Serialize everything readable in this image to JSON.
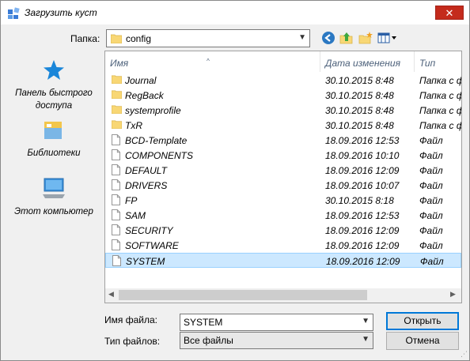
{
  "window": {
    "title": "Загрузить куст",
    "close_glyph": "✕"
  },
  "toolbar": {
    "folder_label": "Папка:",
    "folder_value": "config",
    "icons": [
      "back-icon",
      "up-folder-icon",
      "new-folder-icon",
      "view-menu-icon"
    ]
  },
  "nav": {
    "items": [
      {
        "label": "Панель быстрого доступа",
        "icon": "star-icon"
      },
      {
        "label": "Библиотеки",
        "icon": "libraries-icon"
      },
      {
        "label": "Этот компьютер",
        "icon": "computer-icon"
      }
    ]
  },
  "list": {
    "columns": {
      "name": "Имя",
      "date": "Дата изменения",
      "type": "Тип"
    },
    "sort_arrow": "^",
    "rows": [
      {
        "name": "Journal",
        "date": "30.10.2015 8:48",
        "type": "Папка с ф",
        "kind": "folder",
        "selected": false
      },
      {
        "name": "RegBack",
        "date": "30.10.2015 8:48",
        "type": "Папка с ф",
        "kind": "folder",
        "selected": false
      },
      {
        "name": "systemprofile",
        "date": "30.10.2015 8:48",
        "type": "Папка с ф",
        "kind": "folder",
        "selected": false
      },
      {
        "name": "TxR",
        "date": "30.10.2015 8:48",
        "type": "Папка с ф",
        "kind": "folder",
        "selected": false
      },
      {
        "name": "BCD-Template",
        "date": "18.09.2016 12:53",
        "type": "Файл",
        "kind": "file",
        "selected": false
      },
      {
        "name": "COMPONENTS",
        "date": "18.09.2016 10:10",
        "type": "Файл",
        "kind": "file",
        "selected": false
      },
      {
        "name": "DEFAULT",
        "date": "18.09.2016 12:09",
        "type": "Файл",
        "kind": "file",
        "selected": false
      },
      {
        "name": "DRIVERS",
        "date": "18.09.2016 10:07",
        "type": "Файл",
        "kind": "file",
        "selected": false
      },
      {
        "name": "FP",
        "date": "30.10.2015 8:18",
        "type": "Файл",
        "kind": "file",
        "selected": false
      },
      {
        "name": "SAM",
        "date": "18.09.2016 12:53",
        "type": "Файл",
        "kind": "file",
        "selected": false
      },
      {
        "name": "SECURITY",
        "date": "18.09.2016 12:09",
        "type": "Файл",
        "kind": "file",
        "selected": false
      },
      {
        "name": "SOFTWARE",
        "date": "18.09.2016 12:09",
        "type": "Файл",
        "kind": "file",
        "selected": false
      },
      {
        "name": "SYSTEM",
        "date": "18.09.2016 12:09",
        "type": "Файл",
        "kind": "file",
        "selected": true
      }
    ]
  },
  "bottom": {
    "filename_label": "Имя файла:",
    "filename_value": "SYSTEM",
    "filetype_label": "Тип файлов:",
    "filetype_value": "Все файлы",
    "open_label": "Открыть",
    "cancel_label": "Отмена"
  },
  "colors": {
    "accent": "#0078d7",
    "selection": "#cce8ff",
    "close": "#c42b1c",
    "folder": "#f8d775"
  }
}
